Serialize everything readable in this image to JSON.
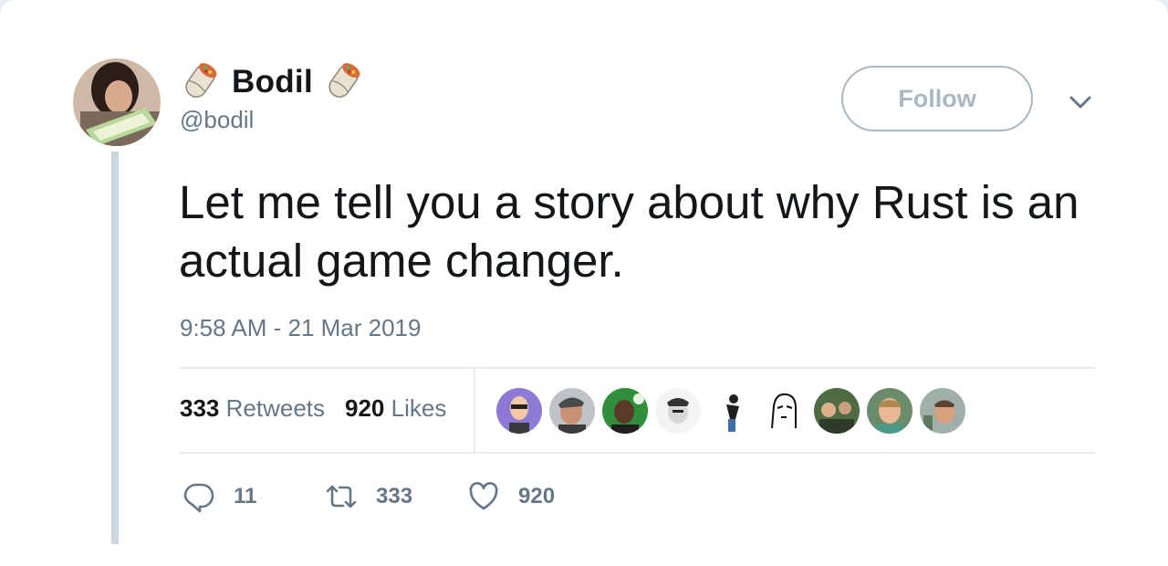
{
  "author": {
    "display_name": "Bodil",
    "handle": "@bodil"
  },
  "follow_label": "Follow",
  "tweet": {
    "text": "Let me tell you a story about why Rust is an actual game changer.",
    "timestamp": "9:58 AM - 21 Mar 2019"
  },
  "stats": {
    "retweets_count": "333",
    "retweets_label": "Retweets",
    "likes_count": "920",
    "likes_label": "Likes"
  },
  "actions": {
    "replies": "11",
    "retweets": "333",
    "likes": "920"
  },
  "icons": {
    "name_emoji": "burrito-icon",
    "reply": "reply-icon",
    "retweet": "retweet-icon",
    "like": "heart-icon",
    "more": "chevron-down-icon"
  },
  "colors": {
    "text": "#14171a",
    "secondary": "#657786",
    "border": "#aab8c2",
    "divider": "#e6ecf0"
  }
}
